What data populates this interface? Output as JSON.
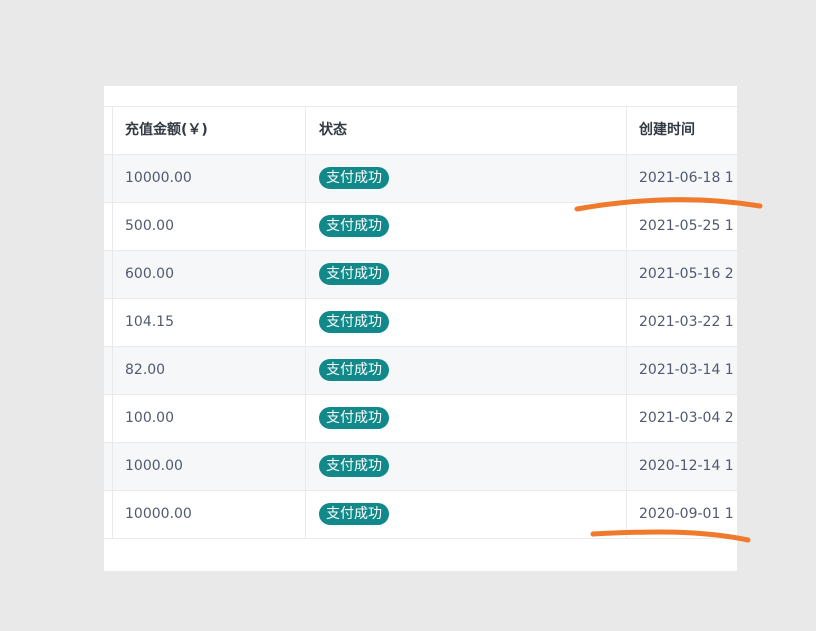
{
  "table": {
    "headers": {
      "amount": "充值金额(￥)",
      "status": "状态",
      "created": "创建时间"
    },
    "rows": [
      {
        "amount": "10000.00",
        "status": "支付成功",
        "created": "2021-06-18 1"
      },
      {
        "amount": "500.00",
        "status": "支付成功",
        "created": "2021-05-25 1"
      },
      {
        "amount": "600.00",
        "status": "支付成功",
        "created": "2021-05-16 2"
      },
      {
        "amount": "104.15",
        "status": "支付成功",
        "created": "2021-03-22 1"
      },
      {
        "amount": "82.00",
        "status": "支付成功",
        "created": "2021-03-14 1"
      },
      {
        "amount": "100.00",
        "status": "支付成功",
        "created": "2021-03-04 2"
      },
      {
        "amount": "1000.00",
        "status": "支付成功",
        "created": "2020-12-14 1"
      },
      {
        "amount": "10000.00",
        "status": "支付成功",
        "created": "2020-09-01 1"
      }
    ]
  },
  "colors": {
    "badge": "#11898a",
    "annotation": "#f07a2c"
  }
}
